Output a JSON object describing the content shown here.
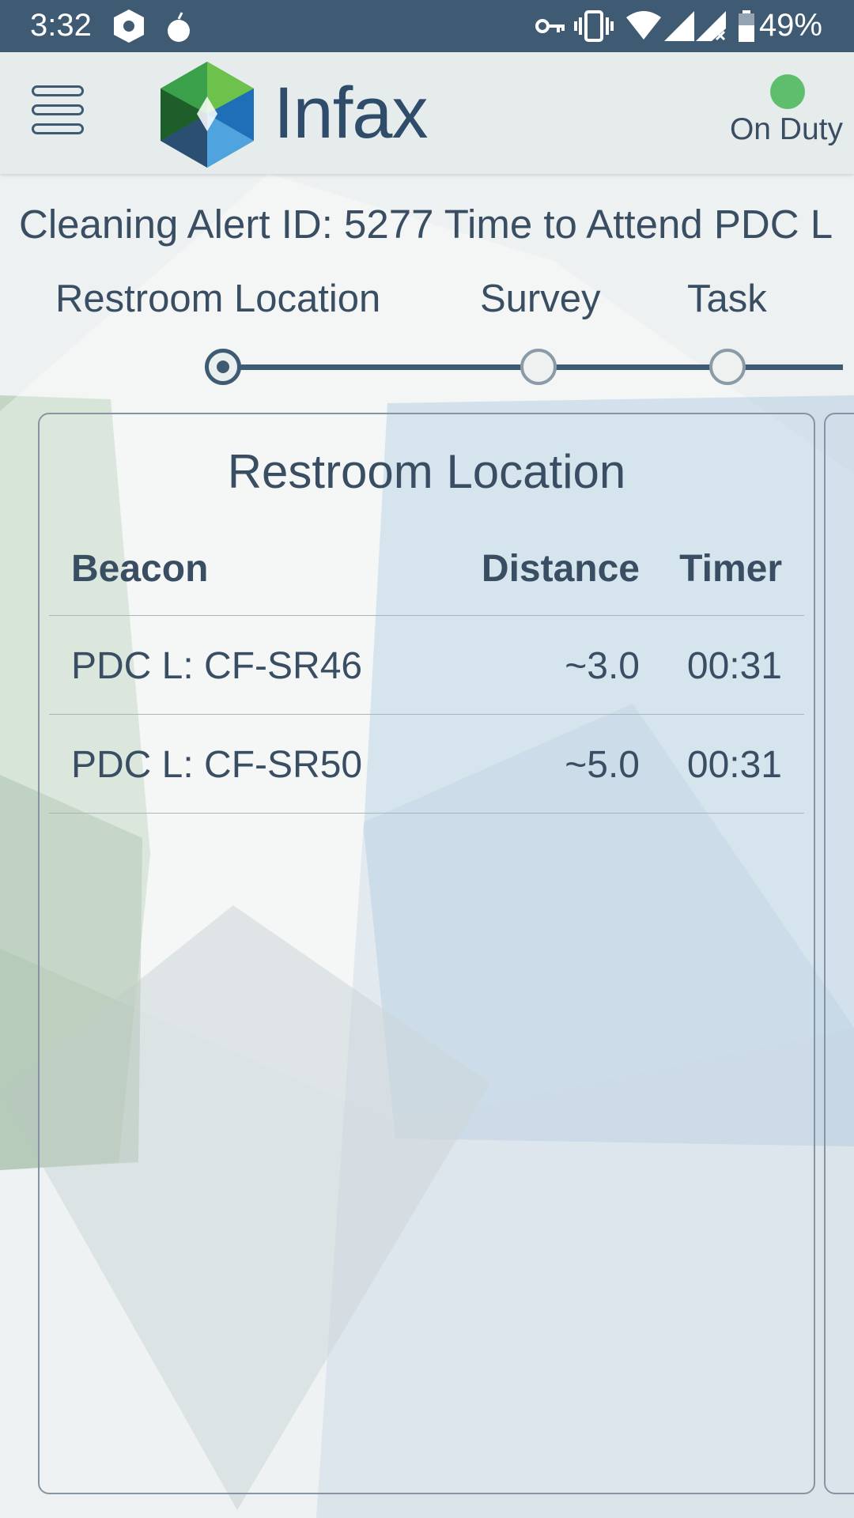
{
  "status_bar": {
    "time": "3:32",
    "battery_percent": "49%",
    "icons": [
      "hexagon-notification-icon",
      "bomb-icon",
      "vpn-key-icon",
      "vibrate-icon",
      "wifi-icon",
      "signal-icon",
      "signal-no-data-icon",
      "battery-icon"
    ]
  },
  "header": {
    "brand": "Infax",
    "duty_status": "On Duty",
    "duty_color": "#5fbe6e"
  },
  "alert": {
    "title": "Cleaning Alert ID: 5277 Time to Attend PDC L"
  },
  "stepper": {
    "steps": [
      {
        "label": "Restroom Location",
        "active": true
      },
      {
        "label": "Survey",
        "active": false
      },
      {
        "label": "Task",
        "active": false
      }
    ]
  },
  "card": {
    "title": "Restroom Location",
    "columns": {
      "beacon": "Beacon",
      "distance": "Distance",
      "timer": "Timer"
    },
    "rows": [
      {
        "beacon": "PDC L: CF-SR46",
        "distance": "~3.0",
        "timer": "00:31"
      },
      {
        "beacon": "PDC L: CF-SR50",
        "distance": "~5.0",
        "timer": "00:31"
      }
    ]
  },
  "colors": {
    "primary": "#3f5a73",
    "text": "#3a4e63",
    "on_duty": "#5fbe6e"
  }
}
